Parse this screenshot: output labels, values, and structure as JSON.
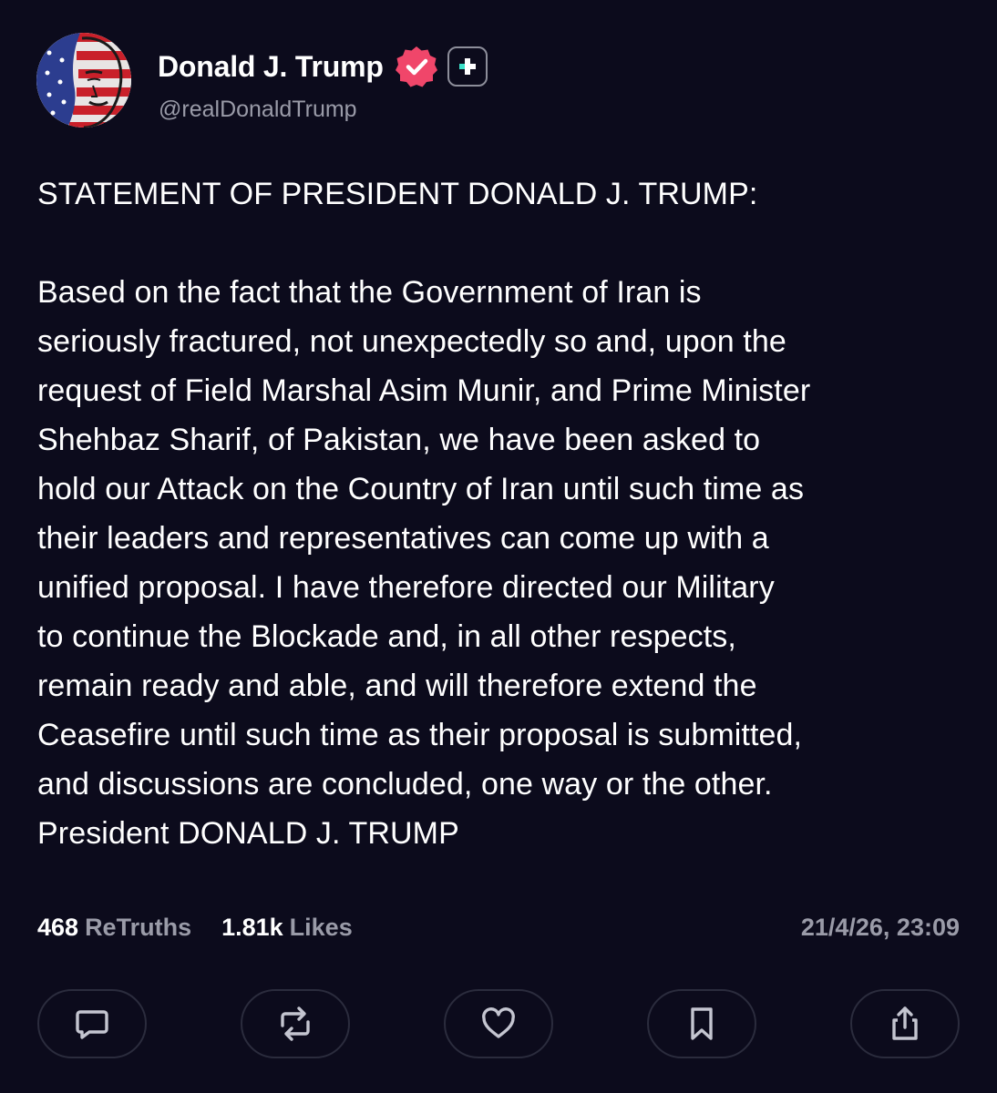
{
  "post": {
    "author": {
      "display_name": "Donald J. Trump",
      "handle": "@realDonaldTrump",
      "verified": true
    },
    "text": "STATEMENT OF PRESIDENT DONALD J. TRUMP:\n\nBased on the fact that the Government of Iran is\nseriously fractured, not unexpectedly so and, upon the\nrequest of Field Marshal Asim Munir, and Prime Minister\nShehbaz Sharif, of Pakistan, we have been asked to\nhold our Attack on the Country of Iran until such time as\ntheir leaders and representatives can come up with a\nunified proposal. I have therefore directed our Military\nto continue the Blockade and, in all other respects,\nremain ready and able, and will therefore extend the\nCeasefire until such time as their proposal is submitted,\nand discussions are concluded, one way or the other.\nPresident DONALD J. TRUMP",
    "stats": {
      "retruths_count": "468",
      "retruths_label": "ReTruths",
      "likes_count": "1.81k",
      "likes_label": "Likes"
    },
    "timestamp": "21/4/26, 23:09"
  },
  "actions": [
    {
      "icon": "comment-icon"
    },
    {
      "icon": "retruth-icon"
    },
    {
      "icon": "heart-icon"
    },
    {
      "icon": "bookmark-icon"
    },
    {
      "icon": "share-icon"
    }
  ],
  "colors": {
    "background": "#0c0b1c",
    "text_primary": "#ffffff",
    "text_secondary": "#9a9ba8",
    "verified_badge": "#f0466a",
    "plus_accent": "#3ce0c8",
    "action_border": "#2b2c3d"
  }
}
